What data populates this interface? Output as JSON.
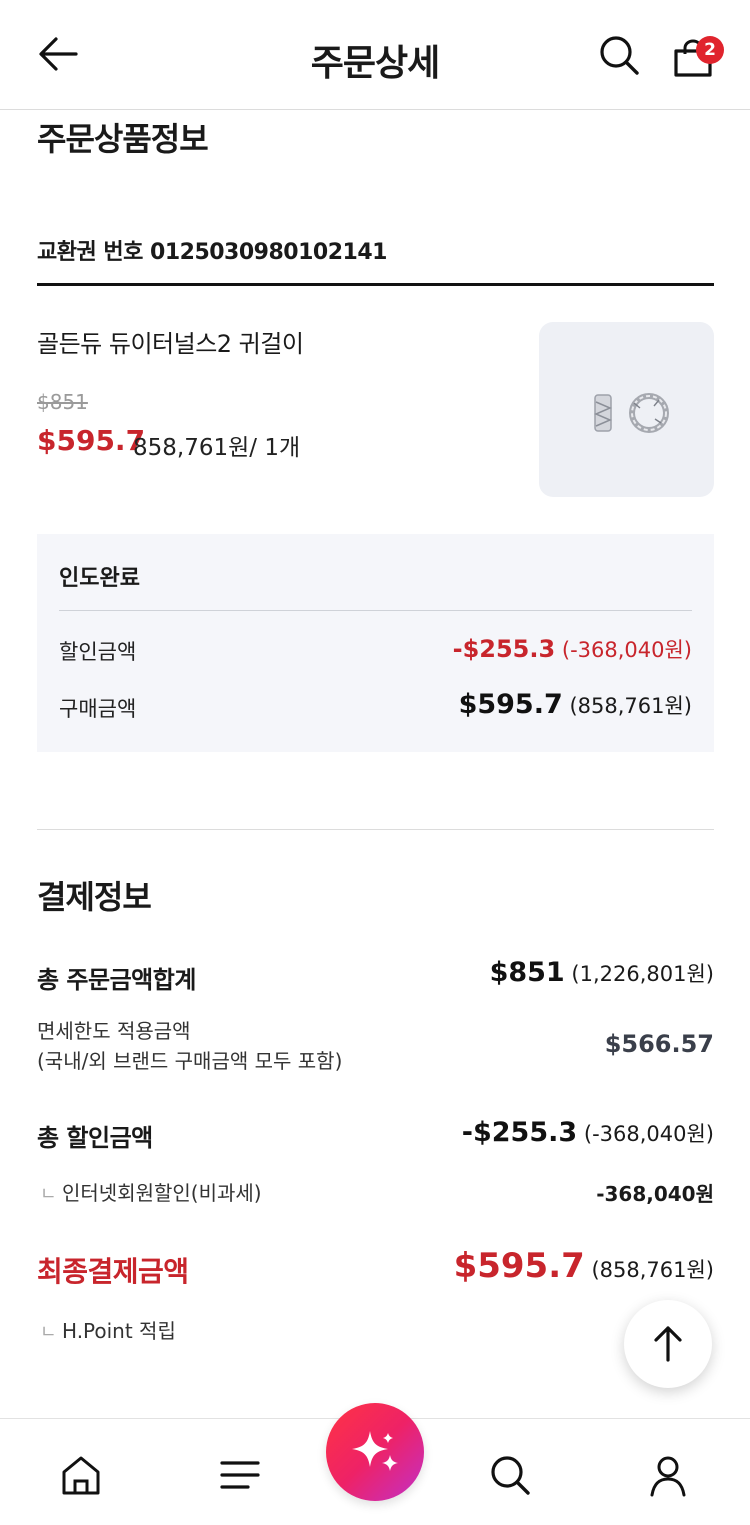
{
  "header": {
    "title": "주문상세",
    "cart_count": "2"
  },
  "product_section": {
    "title": "주문상품정보",
    "voucher": "교환권 번호 0125030980102141",
    "item": {
      "name": "골든듀 듀이터널스2 귀걸이",
      "original_price": "$851",
      "sale_price": "$595.7",
      "krw_qty": "858,761원/ 1개"
    },
    "status": "인도완료",
    "discount_label": "할인금액",
    "discount_usd": "-$255.3",
    "discount_krw": "(-368,040원)",
    "purchase_label": "구매금액",
    "purchase_usd": "$595.7",
    "purchase_krw": "(858,761원)"
  },
  "payment_section": {
    "title": "결제정보",
    "total_order_label": "총 주문금액합계",
    "total_order_usd": "$851",
    "total_order_krw": "(1,226,801원)",
    "duty_free_label_1": "면세한도 적용금액",
    "duty_free_label_2": "(국내/외 브랜드 구매금액 모두 포함)",
    "duty_free_usd": "$566.57",
    "total_discount_label": "총 할인금액",
    "total_discount_usd": "-$255.3",
    "total_discount_krw": "(-368,040원)",
    "bullet": "ㄴ",
    "member_discount_label": "인터넷회원할인(비과세)",
    "member_discount_value": "-368,040원",
    "final_label": "최종결제금액",
    "final_usd": "$595.7",
    "final_krw": "(858,761원)",
    "hpoint_label": "H.Point 적립"
  },
  "bottom_nav": {
    "items": [
      "home-icon",
      "menu-icon",
      "sparkle-icon",
      "search-icon",
      "user-icon"
    ]
  },
  "colors": {
    "accent_red": "#c8252c",
    "badge_red": "#e0242d",
    "status_bg": "#f5f6fa"
  }
}
